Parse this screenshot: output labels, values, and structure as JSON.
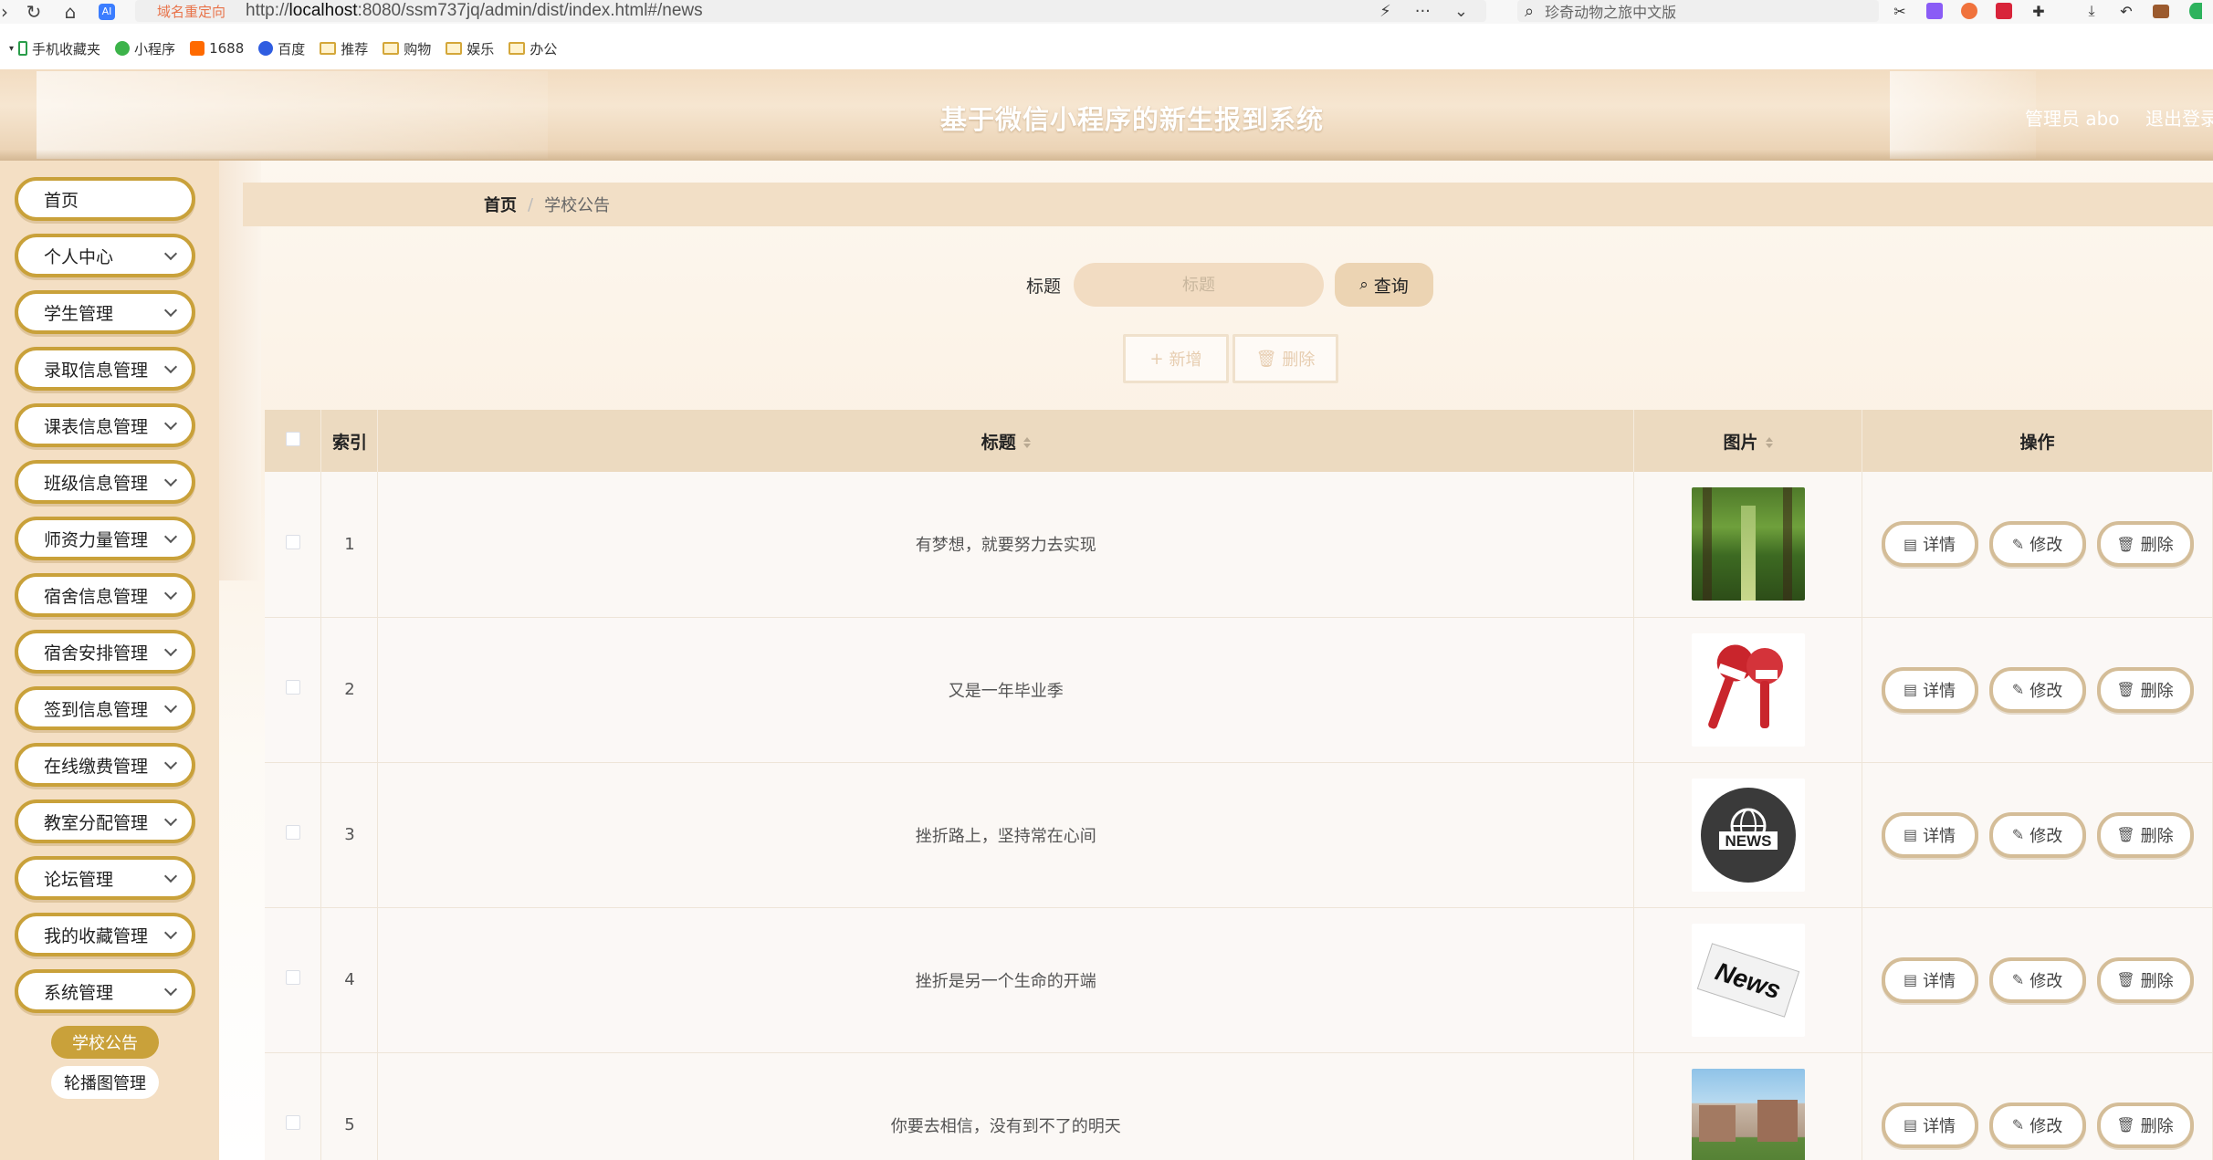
{
  "browser": {
    "redirect_tag": "域名重定向",
    "url_prefix": "http://",
    "url_host": "localhost",
    "url_rest": ":8080/ssm737jq/admin/dist/index.html#/news",
    "search_text": "珍奇动物之旅中文版",
    "bookmarks": [
      "手机收藏夹",
      "小程序",
      "1688",
      "百度",
      "推荐",
      "购物",
      "娱乐",
      "办公"
    ]
  },
  "header": {
    "title": "基于微信小程序的新生报到系统",
    "user": "管理员 abo",
    "logout": "退出登录"
  },
  "sidebar": {
    "items": [
      {
        "label": "首页",
        "has_chevron": false
      },
      {
        "label": "个人中心",
        "has_chevron": true
      },
      {
        "label": "学生管理",
        "has_chevron": true
      },
      {
        "label": "录取信息管理",
        "has_chevron": true
      },
      {
        "label": "课表信息管理",
        "has_chevron": true
      },
      {
        "label": "班级信息管理",
        "has_chevron": true
      },
      {
        "label": "师资力量管理",
        "has_chevron": true
      },
      {
        "label": "宿舍信息管理",
        "has_chevron": true
      },
      {
        "label": "宿舍安排管理",
        "has_chevron": true
      },
      {
        "label": "签到信息管理",
        "has_chevron": true
      },
      {
        "label": "在线缴费管理",
        "has_chevron": true
      },
      {
        "label": "教室分配管理",
        "has_chevron": true
      },
      {
        "label": "论坛管理",
        "has_chevron": true
      },
      {
        "label": "我的收藏管理",
        "has_chevron": true
      },
      {
        "label": "系统管理",
        "has_chevron": true
      }
    ],
    "sub_items": [
      {
        "label": "学校公告",
        "active": true
      },
      {
        "label": "轮播图管理",
        "active": false
      }
    ]
  },
  "breadcrumb": {
    "home": "首页",
    "separator": "/",
    "current": "学校公告"
  },
  "search": {
    "label": "标题",
    "placeholder": "标题",
    "button": "查询"
  },
  "actions": {
    "add": "新增",
    "delete": "删除"
  },
  "table": {
    "headers": {
      "index": "索引",
      "title": "标题",
      "image": "图片",
      "ops": "操作"
    },
    "rows": [
      {
        "index": "1",
        "title": "有梦想，就要努力去实现",
        "image": "forest-path"
      },
      {
        "index": "2",
        "title": "又是一年毕业季",
        "image": "news-microphones"
      },
      {
        "index": "3",
        "title": "挫折路上，坚持常在心间",
        "image": "news-globe"
      },
      {
        "index": "4",
        "title": "挫折是另一个生命的开端",
        "image": "news-paper"
      },
      {
        "index": "5",
        "title": "你要去相信，没有到不了的明天",
        "image": "campus-building"
      }
    ],
    "op_labels": {
      "detail": "详情",
      "edit": "修改",
      "delete": "删除"
    }
  },
  "colors": {
    "accent": "#c9a13a",
    "header_bg": "#f2dcc1",
    "sidebar_bg": "#f4dfc4",
    "table_header": "#ecdac0"
  }
}
